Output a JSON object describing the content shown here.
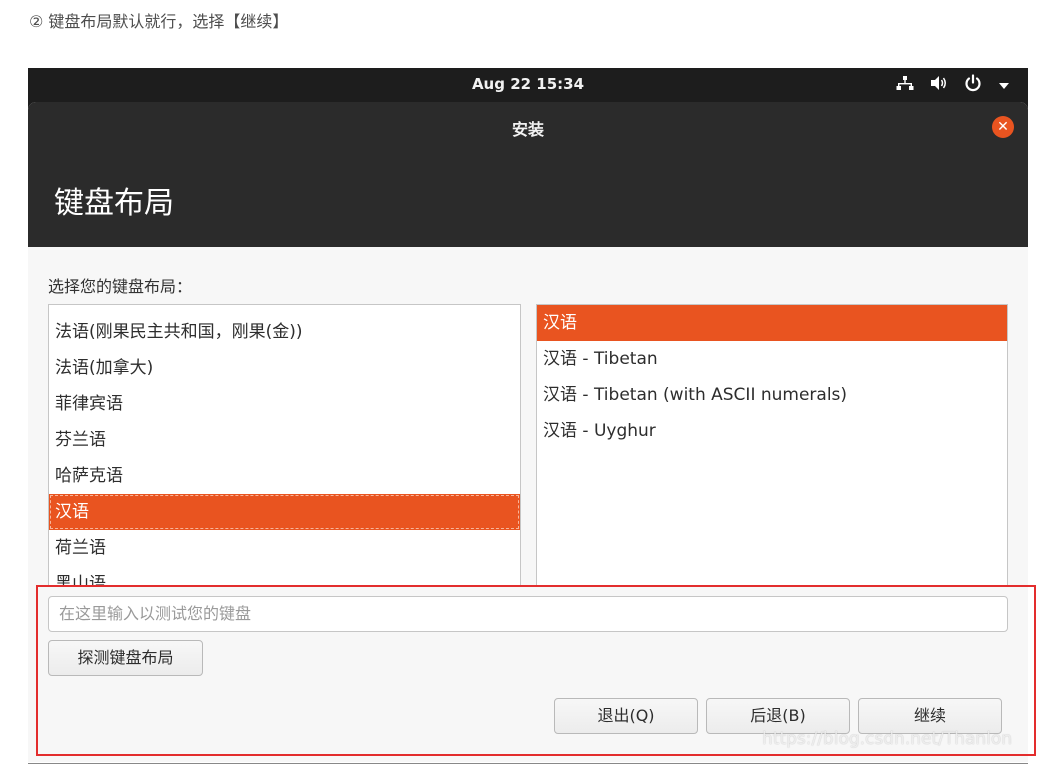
{
  "caption": "② 键盘布局默认就行，选择【继续】",
  "topbar": {
    "clock": "Aug 22  15:34",
    "network_icon": "network-icon",
    "volume_icon": "volume-icon",
    "power_icon": "power-icon",
    "menu_icon": "chevron-down-icon"
  },
  "window": {
    "title": "安装",
    "page_title": "键盘布局"
  },
  "prompt": "选择您的键盘布局：",
  "layouts": [
    "法语(刚果民主共和国，刚果(金))",
    "法语(加拿大)",
    "菲律宾语",
    "芬兰语",
    "哈萨克语",
    "汉语",
    "荷兰语",
    "黑山语"
  ],
  "layouts_selected": "汉语",
  "variants": [
    "汉语",
    "汉语 - Tibetan",
    "汉语 - Tibetan (with ASCII numerals)",
    "汉语 - Uyghur"
  ],
  "variants_selected": "汉语",
  "test_input": {
    "placeholder": "在这里输入以测试您的键盘",
    "value": ""
  },
  "buttons": {
    "detect": "探测键盘布局",
    "quit": "退出(Q)",
    "back": "后退(B)",
    "continue": "继续"
  },
  "watermark": "https://blog.csdn.net/Thanlon",
  "colors": {
    "accent": "#e95420",
    "annotation": "#e32d2d"
  }
}
